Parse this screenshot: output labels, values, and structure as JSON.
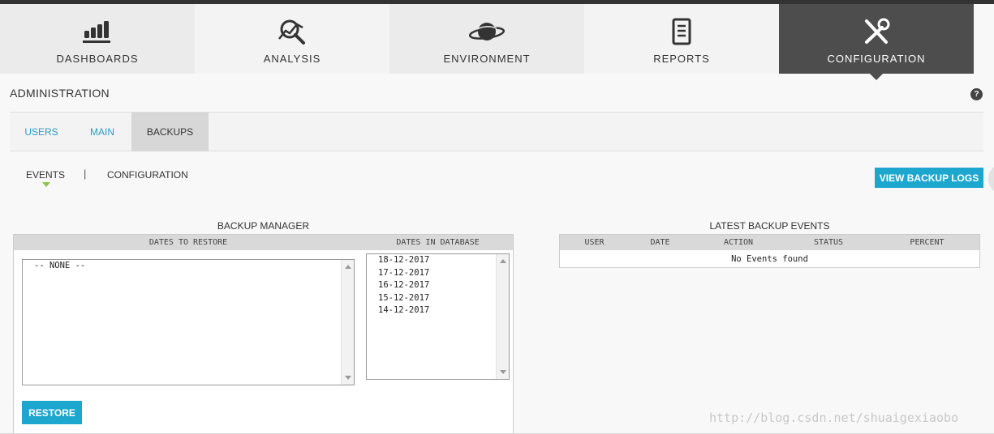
{
  "nav": {
    "items": [
      {
        "label": "DASHBOARDS",
        "icon": "bar-chart-icon"
      },
      {
        "label": "ANALYSIS",
        "icon": "magnifier-chart-icon"
      },
      {
        "label": "ENVIRONMENT",
        "icon": "planet-icon"
      },
      {
        "label": "REPORTS",
        "icon": "document-icon"
      },
      {
        "label": "CONFIGURATION",
        "icon": "tools-icon"
      }
    ],
    "active": "CONFIGURATION"
  },
  "page": {
    "title": "ADMINISTRATION",
    "help_glyph": "?"
  },
  "subtabs": [
    {
      "label": "USERS"
    },
    {
      "label": "MAIN"
    },
    {
      "label": "BACKUPS"
    }
  ],
  "section_nav": {
    "events": "EVENTS",
    "separator": "|",
    "configuration": "CONFIGURATION"
  },
  "actions": {
    "view_logs": "VIEW BACKUP LOGS",
    "restore": "RESTORE"
  },
  "backup_manager": {
    "title": "BACKUP MANAGER",
    "col_restore": "DATES TO RESTORE",
    "col_database": "DATES IN DATABASE",
    "restore_list": [
      "-- NONE --"
    ],
    "database_list": [
      "18-12-2017",
      "17-12-2017",
      "16-12-2017",
      "15-12-2017",
      "14-12-2017"
    ]
  },
  "latest_events": {
    "title": "LATEST BACKUP EVENTS",
    "columns": [
      "USER",
      "DATE",
      "ACTION",
      "STATUS",
      "PERCENT"
    ],
    "empty_text": "No Events found"
  },
  "watermark": "http://blog.csdn.net/shuaigexiaobo",
  "colors": {
    "accent_blue": "#1da7cf",
    "link_blue": "#2a9bc4",
    "active_nav": "#4d4d4d",
    "caret_green": "#8bc34a"
  }
}
